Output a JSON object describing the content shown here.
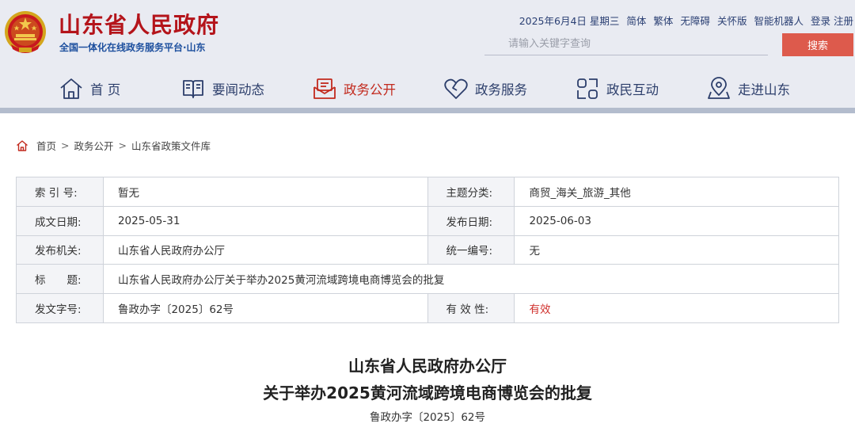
{
  "header": {
    "site_title": "山东省人民政府",
    "site_subtitle": "全国一体化在线政务服务平台·山东",
    "top_links": {
      "date": "2025年6月4日 星期三",
      "simplified": "简体",
      "traditional": "繁体",
      "accessible": "无障碍",
      "elderly": "关怀版",
      "robot": "智能机器人",
      "login": "登录",
      "register": "注册"
    },
    "search": {
      "placeholder": "请输入关键字查询",
      "value": "",
      "button_label": "搜索"
    },
    "nav": {
      "items": [
        {
          "label": "首 页",
          "icon": "home-icon",
          "active": false
        },
        {
          "label": "要闻动态",
          "icon": "book-icon",
          "active": false
        },
        {
          "label": "政务公开",
          "icon": "mail-icon",
          "active": true
        },
        {
          "label": "政务服务",
          "icon": "heart-icon",
          "active": false
        },
        {
          "label": "政民互动",
          "icon": "link-icon",
          "active": false
        },
        {
          "label": "走进山东",
          "icon": "location-icon",
          "active": false
        }
      ]
    }
  },
  "colors": {
    "brand_red": "#b4141b",
    "brand_blue": "#1d4f9e",
    "nav_text": "#2c3e6b",
    "active_red": "#c22a1e",
    "search_button": "#dd5a4c",
    "status_red": "#d0312d"
  },
  "breadcrumb": {
    "icon": "home-icon",
    "items": [
      "首页",
      "政务公开",
      "山东省政策文件库"
    ],
    "separator": ">"
  },
  "info_table": {
    "index_no_label": "索 引 号:",
    "index_no_value": "暂无",
    "topic_label": "主题分类:",
    "topic_value": "商贸_海关_旅游_其他",
    "written_date_label": "成文日期:",
    "written_date_value": "2025-05-31",
    "publish_date_label": "发布日期:",
    "publish_date_value": "2025-06-03",
    "issuer_label": "发布机关:",
    "issuer_value": "山东省人民政府办公厅",
    "serial_label": "统一编号:",
    "serial_value": "无",
    "title_label": "标　　题:",
    "title_value": "山东省人民政府办公厅关于举办2025黄河流域跨境电商博览会的批复",
    "doc_no_label": "发文字号:",
    "doc_no_value": "鲁政办字〔2025〕62号",
    "validity_label": "有 效 性:",
    "validity_value": "有效"
  },
  "document": {
    "title_line1": "山东省人民政府办公厅",
    "title_line2": "关于举办2025黄河流域跨境电商博览会的批复",
    "doc_number": "鲁政办字〔2025〕62号"
  }
}
